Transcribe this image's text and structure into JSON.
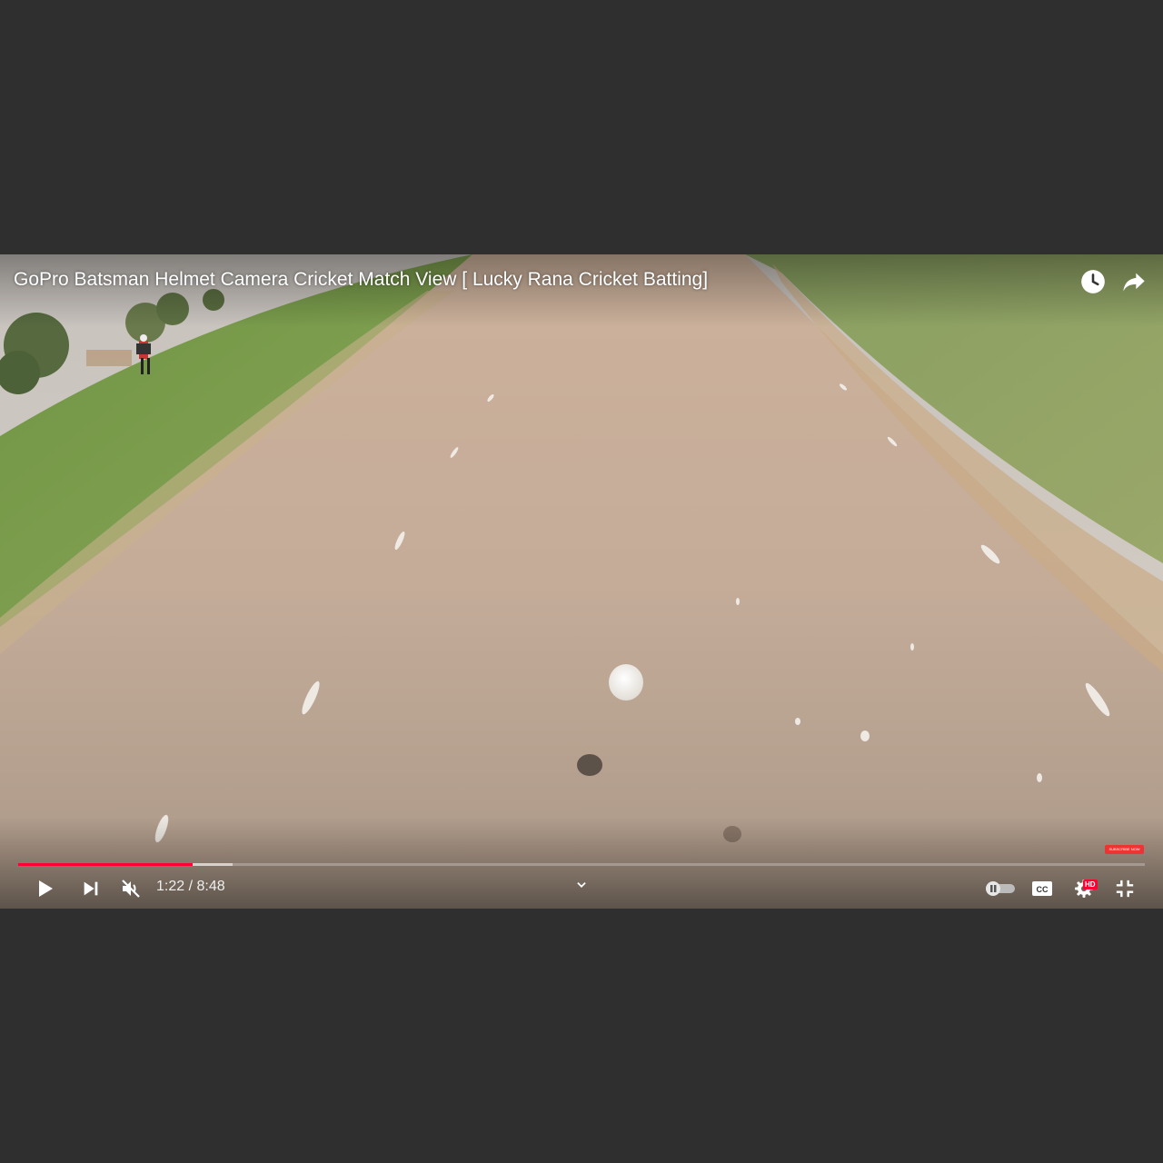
{
  "video": {
    "title": "GoPro Batsman Helmet Camera Cricket Match View [ Lucky Rana Cricket Batting]"
  },
  "top_actions": {
    "watch_later_icon": "clock-icon",
    "share_icon": "share-arrow-icon"
  },
  "progress": {
    "played_fraction": 0.155,
    "buffered_fraction": 0.19,
    "played_color": "#ff0033"
  },
  "endcard": {
    "label": "SUBSCRIBE NOW"
  },
  "controls": {
    "play_icon": "play-icon",
    "next_icon": "next-icon",
    "volume_icon": "muted-volume-icon",
    "current_time": "1:22",
    "separator": "/",
    "duration": "8:48",
    "chapters_icon": "chevron-down-icon",
    "autoplay_icon": "autoplay-toggle-icon",
    "captions_label": "CC",
    "settings_icon": "gear-icon",
    "quality_badge": "HD",
    "fullscreen_icon": "exit-fullscreen-icon"
  }
}
